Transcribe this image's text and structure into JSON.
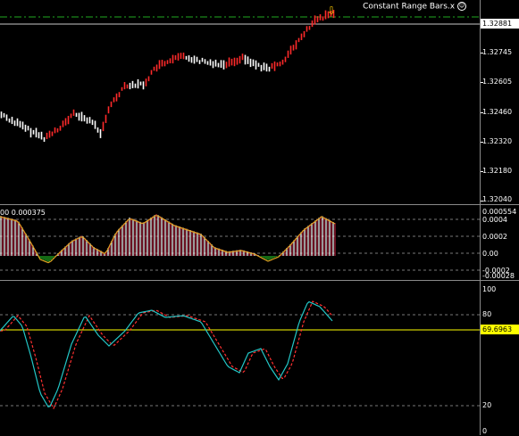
{
  "indicator_name": "Constant Range Bars.x",
  "smiley_icon": "smiley-face-icon",
  "arrow_icon": "down-arrow-icon",
  "main_pane": {
    "price_axis": [
      "1.32745",
      "1.32605",
      "1.32460",
      "1.32320",
      "1.32180",
      "1.32040"
    ],
    "current_price": "1.32881",
    "current_price_color": "#ffffff"
  },
  "osc_pane": {
    "label": "00 0.000375",
    "axis": [
      "0.000554",
      "0.0004",
      "0.0002",
      "0.00",
      "-0.0002",
      "-0.00028"
    ]
  },
  "stoch_pane": {
    "axis": [
      "100",
      "80",
      "20",
      "0"
    ],
    "current_value": "69.6963",
    "level_color": "#ffff00"
  },
  "colors": {
    "bull_bar": "#ff2a2a",
    "bear_bar": "#ffffff",
    "osc_pos": "#b01f3a",
    "osc_neg": "#23b223",
    "main_line": "#23c7c7",
    "signal_line": "#ff3030"
  }
}
